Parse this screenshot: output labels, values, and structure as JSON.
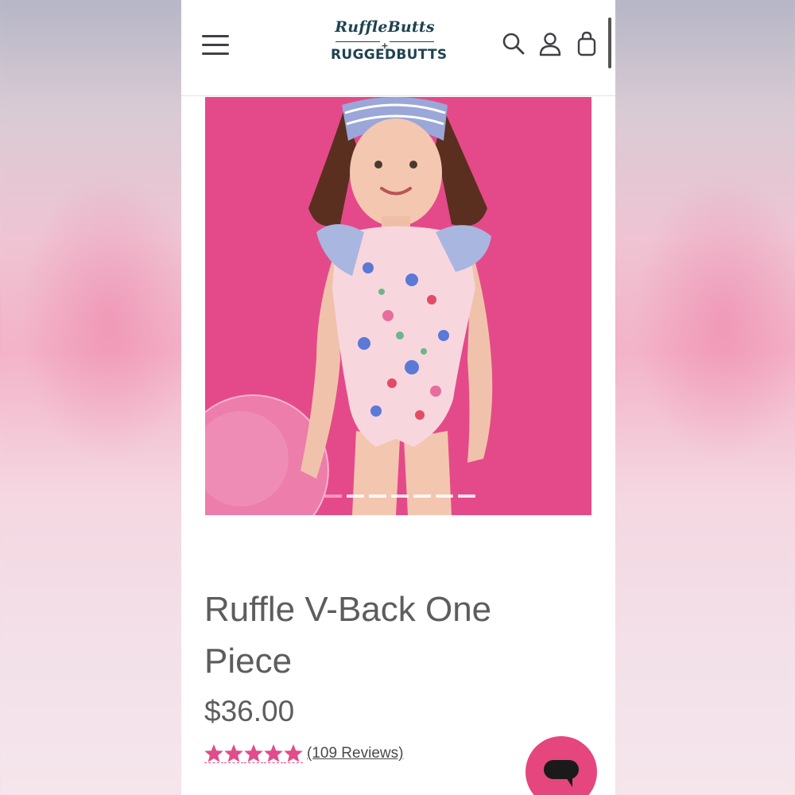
{
  "header": {
    "logo_line1": "RuffleButts",
    "logo_plus": "+",
    "logo_line2": "RUGGEDBUTTS",
    "icons": [
      "menu-icon",
      "search-icon",
      "account-icon",
      "cart-icon"
    ]
  },
  "product": {
    "title": "Ruffle V-Back One Piece",
    "price": "$36.00",
    "rating": 5,
    "rating_max": 5,
    "reviews_label": "(109 Reviews)"
  },
  "carousel": {
    "slide_count": 7,
    "active_index": 0
  },
  "colors": {
    "accent": "#e5467d",
    "star": "#e14c8a",
    "image_background": "#e44a89",
    "text": "#5d5d5d",
    "brand": "#1f4250"
  },
  "chat": {
    "icon": "chat-bubble-icon"
  }
}
